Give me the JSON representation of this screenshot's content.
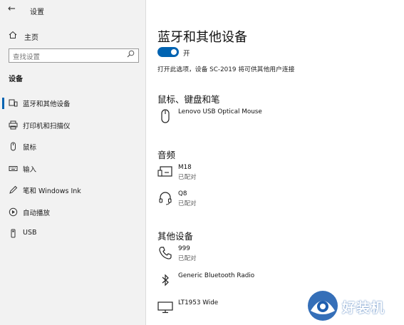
{
  "window": {
    "title": "设置",
    "back_glyph": "←"
  },
  "sidebar": {
    "home": {
      "label": "主页",
      "icon": "home-icon"
    },
    "search": {
      "placeholder": "查找设置",
      "icon": "search-icon"
    },
    "section_label": "设备",
    "items": [
      {
        "label": "蓝牙和其他设备",
        "icon": "bluetooth-devices-icon",
        "active": true
      },
      {
        "label": "打印机和扫描仪",
        "icon": "printer-icon",
        "active": false
      },
      {
        "label": "鼠标",
        "icon": "mouse-icon",
        "active": false
      },
      {
        "label": "输入",
        "icon": "keyboard-icon",
        "active": false
      },
      {
        "label": "笔和 Windows Ink",
        "icon": "pen-icon",
        "active": false
      },
      {
        "label": "自动播放",
        "icon": "autoplay-icon",
        "active": false
      },
      {
        "label": "USB",
        "icon": "usb-icon",
        "active": false
      }
    ]
  },
  "main": {
    "title": "蓝牙和其他设备",
    "bluetooth_toggle": {
      "state_label": "开",
      "on": true
    },
    "description": "打开此选项，设备 SC-2019 将可供其他用户连接",
    "sections": [
      {
        "heading": "鼠标、键盘和笔",
        "devices": [
          {
            "name": "Lenovo USB Optical Mouse",
            "status": "",
            "icon": "mouse-icon"
          }
        ]
      },
      {
        "heading": "音频",
        "devices": [
          {
            "name": "M18",
            "status": "已配对",
            "icon": "audio-device-icon"
          },
          {
            "name": "Q8",
            "status": "已配对",
            "icon": "headset-icon"
          }
        ]
      },
      {
        "heading": "其他设备",
        "devices": [
          {
            "name": "999",
            "status": "已配对",
            "icon": "phone-icon"
          },
          {
            "name": "Generic Bluetooth Radio",
            "status": "",
            "icon": "bluetooth-icon"
          },
          {
            "name": "LT1953 Wide",
            "status": "",
            "icon": "monitor-icon"
          }
        ]
      }
    ]
  },
  "watermark": {
    "text": "好装机"
  },
  "colors": {
    "accent": "#0063b1",
    "sidebar_bg": "#f2f2f2"
  }
}
